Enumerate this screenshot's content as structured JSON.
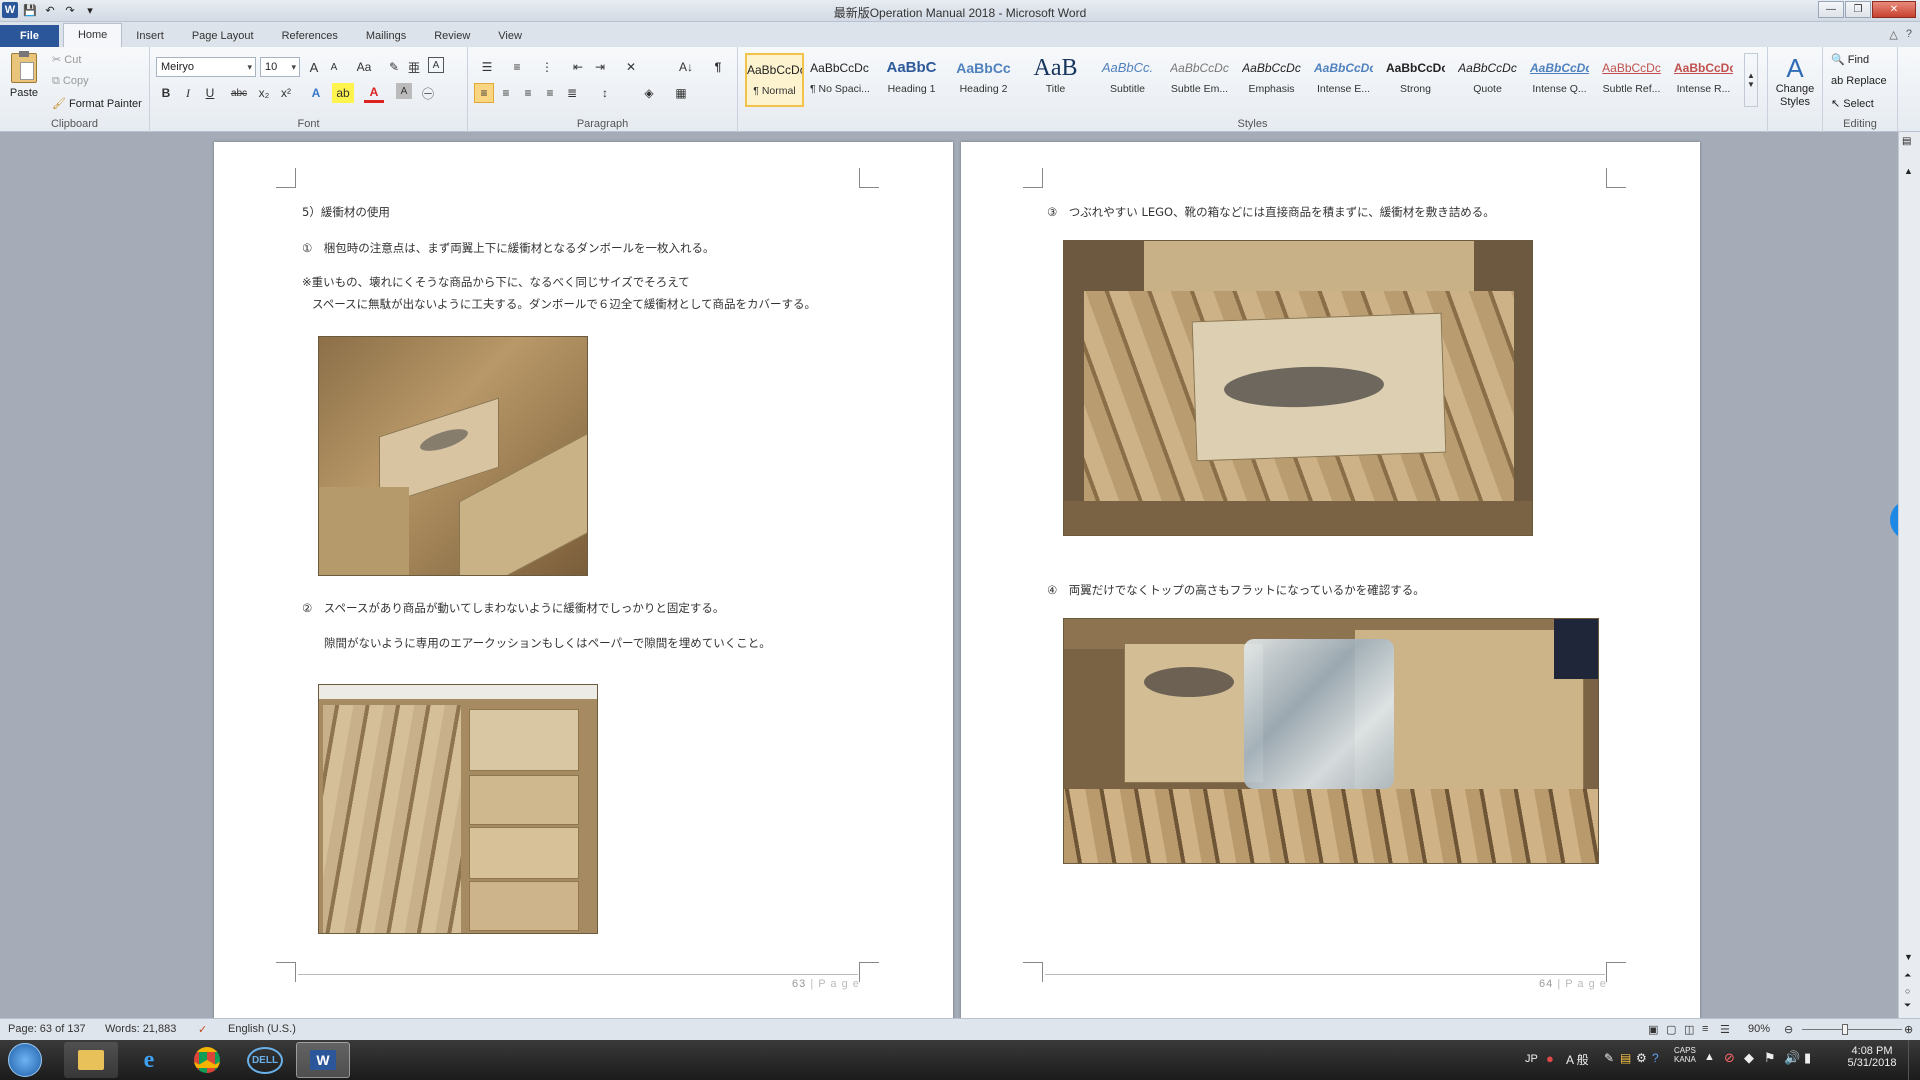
{
  "window": {
    "title": "最新版Operation Manual 2018 - Microsoft Word",
    "controls": {
      "minimize": "—",
      "restore": "❐",
      "close": "✕"
    }
  },
  "qat": {
    "word_logo": "W",
    "save": "💾",
    "undo": "↶",
    "redo": "↷",
    "customize": "▾"
  },
  "tabs": [
    "File",
    "Home",
    "Insert",
    "Page Layout",
    "References",
    "Mailings",
    "Review",
    "View"
  ],
  "active_tab": "Home",
  "tabs_right": {
    "minimize_ribbon": "△",
    "help": "?"
  },
  "ribbon": {
    "clipboard": {
      "label": "Clipboard",
      "paste": "Paste",
      "cut": "Cut",
      "copy": "Copy",
      "format_painter": "Format Painter"
    },
    "font": {
      "label": "Font",
      "font_name": "Meiryo",
      "font_size": "10",
      "bold": "B",
      "italic": "I",
      "underline": "U",
      "strike": "abc",
      "subscript": "x₂",
      "superscript": "x²",
      "grow": "A",
      "shrink": "A",
      "change_case": "Aa",
      "clear": "A",
      "font_color": "A",
      "highlight": "ab"
    },
    "paragraph": {
      "label": "Paragraph",
      "show_marks": "¶",
      "sort": "A↓"
    },
    "styles": {
      "label": "Styles",
      "items": [
        {
          "sample": "AaBbCcDc",
          "name": "¶ Normal"
        },
        {
          "sample": "AaBbCcDc",
          "name": "¶ No Spaci..."
        },
        {
          "sample": "AaBbC",
          "name": "Heading 1"
        },
        {
          "sample": "AaBbCc",
          "name": "Heading 2"
        },
        {
          "sample": "AaB",
          "name": "Title"
        },
        {
          "sample": "AaBbCc.",
          "name": "Subtitle"
        },
        {
          "sample": "AaBbCcDc",
          "name": "Subtle Em..."
        },
        {
          "sample": "AaBbCcDc",
          "name": "Emphasis"
        },
        {
          "sample": "AaBbCcDc",
          "name": "Intense E..."
        },
        {
          "sample": "AaBbCcDc",
          "name": "Strong"
        },
        {
          "sample": "AaBbCcDc",
          "name": "Quote"
        },
        {
          "sample": "AaBbCcDc",
          "name": "Intense Q..."
        },
        {
          "sample": "AaBbCcDc",
          "name": "Subtle Ref..."
        },
        {
          "sample": "AaBbCcDc",
          "name": "Intense R..."
        }
      ],
      "change_styles": "Change Styles"
    },
    "editing": {
      "label": "Editing",
      "find": "Find",
      "replace": "Replace",
      "select": "Select"
    }
  },
  "page_left": {
    "heading": "5）緩衝材の使用",
    "p1": "①　梱包時の注意点は、まず両翼上下に緩衝材となるダンボールを一枚入れる。",
    "note1": "※重いもの、壊れにくそうな商品から下に、なるべく同じサイズでそろえて",
    "note2": "スペースに無駄が出ないように工夫する。ダンボールで６辺全て緩衝材として商品をカバーする。",
    "p2": "②　スペースがあり商品が動いてしまわないように緩衝材でしっかりと固定する。",
    "p3": "隙間がないように専用のエアークッションもしくはペーパーで隙間を埋めていくこと。",
    "footer_num": "63",
    "footer_word": "| P a g e"
  },
  "page_right": {
    "p1": "③　つぶれやすい LEGO、靴の箱などには直接商品を積まずに、緩衝材を敷き詰める。",
    "p2": "④　両翼だけでなくトップの高さもフラットになっているかを確認する。",
    "footer_num": "64",
    "footer_word": "| P a g e"
  },
  "status": {
    "page": "Page: 63 of 137",
    "words": "Words: 21,883",
    "language": "English (U.S.)",
    "zoom": "90%"
  },
  "taskbar": {
    "dell_label": "DELL",
    "word_label": "W",
    "time": "4:08 PM",
    "date": "5/31/2018",
    "ime": "JP",
    "ime_mode": "A 般",
    "caps": "CAPS",
    "kana": "KANA"
  },
  "colors": {
    "file_tab": "#2b579a",
    "doc_bg": "#a5acb8",
    "selected_style": "#f2c24a"
  }
}
